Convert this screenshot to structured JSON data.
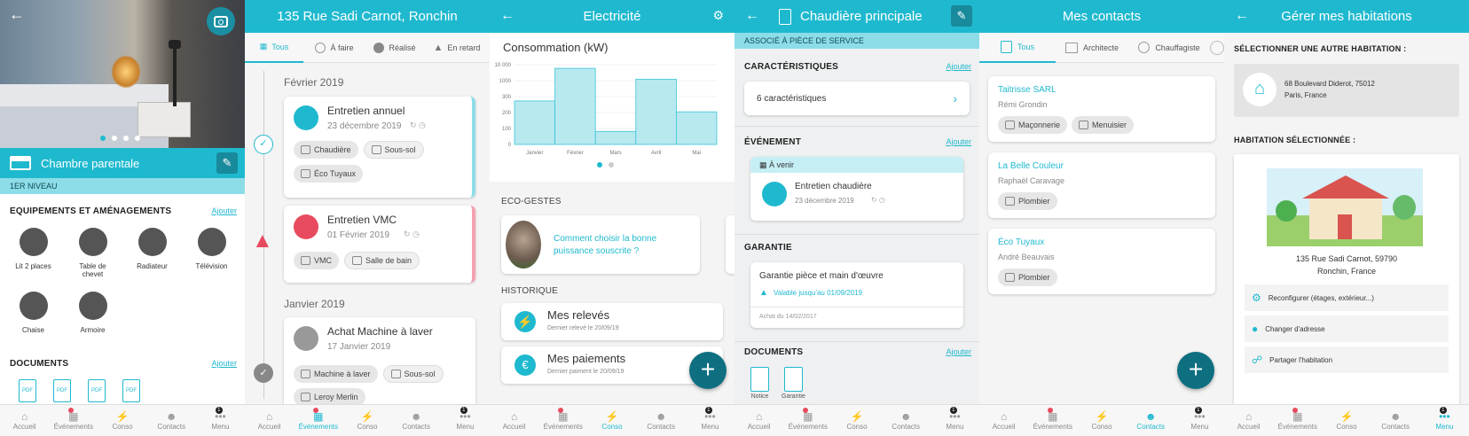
{
  "tabbar": {
    "items": [
      "Accueil",
      "Événements",
      "Conso",
      "Contacts",
      "Menu"
    ],
    "badge": "1"
  },
  "p1": {
    "room_title": "Chambre parentale",
    "level": "1ER NIVEAU",
    "equip_title": "EQUIPEMENTS ET AMÉNAGEMENTS",
    "add": "Ajouter",
    "equipments": [
      "Lit 2 places",
      "Table de chevet",
      "Radiateur",
      "Télévision",
      "Chaise",
      "Armoire"
    ],
    "docs_title": "DOCUMENTS",
    "doc_label": "PDF"
  },
  "p2": {
    "title": "135 Rue Sadi Carnot, Ronchin",
    "filters": [
      "Tous",
      "À faire",
      "Réalisé",
      "En retard"
    ],
    "month1": "Février 2019",
    "month2": "Janvier 2019",
    "events": [
      {
        "title": "Entretien annuel",
        "date": "23 décembre 2019",
        "chips": [
          "Chaudière",
          "Sous-sol",
          "Éco Tuyaux"
        ]
      },
      {
        "title": "Entretien VMC",
        "date": "01 Février 2019",
        "chips": [
          "VMC",
          "Salle de bain"
        ]
      },
      {
        "title": "Achat Machine à laver",
        "date": "17 Janvier 2019",
        "chips": [
          "Machine à laver",
          "Sous-sol",
          "Leroy Merlin"
        ]
      }
    ]
  },
  "p3": {
    "title": "Electricité",
    "chart_title": "Consommation (kW)",
    "eco_title": "ECO-GESTES",
    "eco_text": "Comment choisir la bonne puissance souscrite ?",
    "hist_title": "HISTORIQUE",
    "releves": "Mes relevés",
    "releves_sub": "Dernier relevé le 20/09/19",
    "paiements": "Mes paiements",
    "paiements_sub": "Dernier paiment le 20/09/19"
  },
  "chart_data": {
    "type": "bar",
    "categories": [
      "Janvier",
      "Février",
      "Mars",
      "Avril",
      "Mai"
    ],
    "values": [
      600,
      1050,
      180,
      900,
      450
    ],
    "yticks": [
      "10 000",
      "1000",
      "300",
      "200",
      "100",
      "0"
    ],
    "ylabel": "Consommation (kW)"
  },
  "p4": {
    "title": "Chaudière principale",
    "assoc": "ASSOCIÉ À PIÈCE DE SERVICE",
    "car_title": "CARACTÉRISTIQUES",
    "add": "Ajouter",
    "car_count": "6 caractéristiques",
    "evt_title": "ÉVÉNEMENT",
    "avenir": "À venir",
    "evt_name": "Entretien chaudière",
    "evt_date": "23 décembre 2019",
    "gar_title": "GARANTIE",
    "gar_name": "Garantie pièce et main d'œuvre",
    "gar_valid": "Valable jusqu'au 01/09/2019",
    "gar_buy": "Achat du 14/02/2017",
    "docs_title": "DOCUMENTS",
    "docs": [
      "Notice",
      "Garantie"
    ]
  },
  "p5": {
    "title": "Mes contacts",
    "filters": [
      "Tous",
      "Architecte",
      "Chauffagiste"
    ],
    "contacts": [
      {
        "name": "Taitrisse SARL",
        "person": "Rémi Grondin",
        "chips": [
          "Maçonnerie",
          "Menuisier"
        ]
      },
      {
        "name": "La Belle Couleur",
        "person": "Raphaël Caravage",
        "chips": [
          "Plombier"
        ]
      },
      {
        "name": "Éco Tuyaux",
        "person": "André Beauvais",
        "chips": [
          "Plombier"
        ]
      }
    ]
  },
  "p6": {
    "title": "Gérer mes habitations",
    "select_other": "SÉLECTIONNER UNE AUTRE HABITATION :",
    "other_addr1": "68 Boulevard Diderot, 75012",
    "other_addr2": "Paris, France",
    "selected_title": "HABITATION SÉLECTIONNÉE :",
    "sel_addr1": "135 Rue Sadi Carnot, 59790",
    "sel_addr2": "Ronchin, France",
    "actions": [
      "Reconfigurer (étages, extérieur...)",
      "Changer d'adresse",
      "Partager l'habitation"
    ]
  },
  "colors": {
    "teal": "#1fb9cf",
    "dark_teal": "#0d6f80",
    "alert": "#e84a5f"
  }
}
